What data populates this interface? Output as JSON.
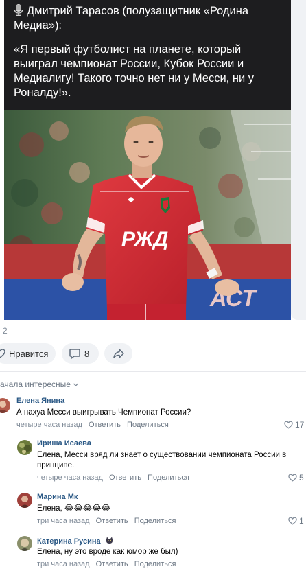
{
  "post": {
    "quote_title": "Дмитрий Тарасов (полузащитник «Родина Медиа»):",
    "quote_text": "«Я первый футболист на планете, который выиграл чемпионат России, Кубок России и Медиалигу! Такого точно нет ни у Месси, ни у Роналду!».",
    "jersey_logo": "РЖД",
    "banner_text": "АСТ",
    "views": "2",
    "like_label": "Нравится",
    "comments_count": "8"
  },
  "comments_header": {
    "sort_label": "ачала интересные"
  },
  "comments": [
    {
      "author": "Елена Янина",
      "text": "А нахуа Месси выигрывать Чемпионат России?",
      "time": "четыре часа назад",
      "reply": "Ответить",
      "share": "Поделиться",
      "likes": "17",
      "avatar_color": "#b35a4a"
    },
    {
      "author": "Ириша Исаева",
      "text": "Елена, Месси вряд ли знает о существовании чемпионата России в принципе.",
      "time": "четыре часа назад",
      "reply": "Ответить",
      "share": "Поделиться",
      "likes": "5",
      "avatar_color": "#6b7a3a"
    },
    {
      "author": "Марина Мк",
      "text": "Елена, 😂😂😂😂😂",
      "time": "три часа назад",
      "reply": "Ответить",
      "share": "Поделиться",
      "likes": "1",
      "avatar_color": "#a0403a"
    },
    {
      "author": "Катерина Русина",
      "text": "Елена, ну это вроде как юмор же был)",
      "time": "три часа назад",
      "reply": "Ответить",
      "share": "Поделиться",
      "likes": "",
      "avatar_color": "#8a8f6a"
    }
  ],
  "colors": {
    "link": "#2a5885",
    "meta": "#818c99",
    "quote_bg": "#1d1d1f",
    "jersey": "#d42a34"
  }
}
